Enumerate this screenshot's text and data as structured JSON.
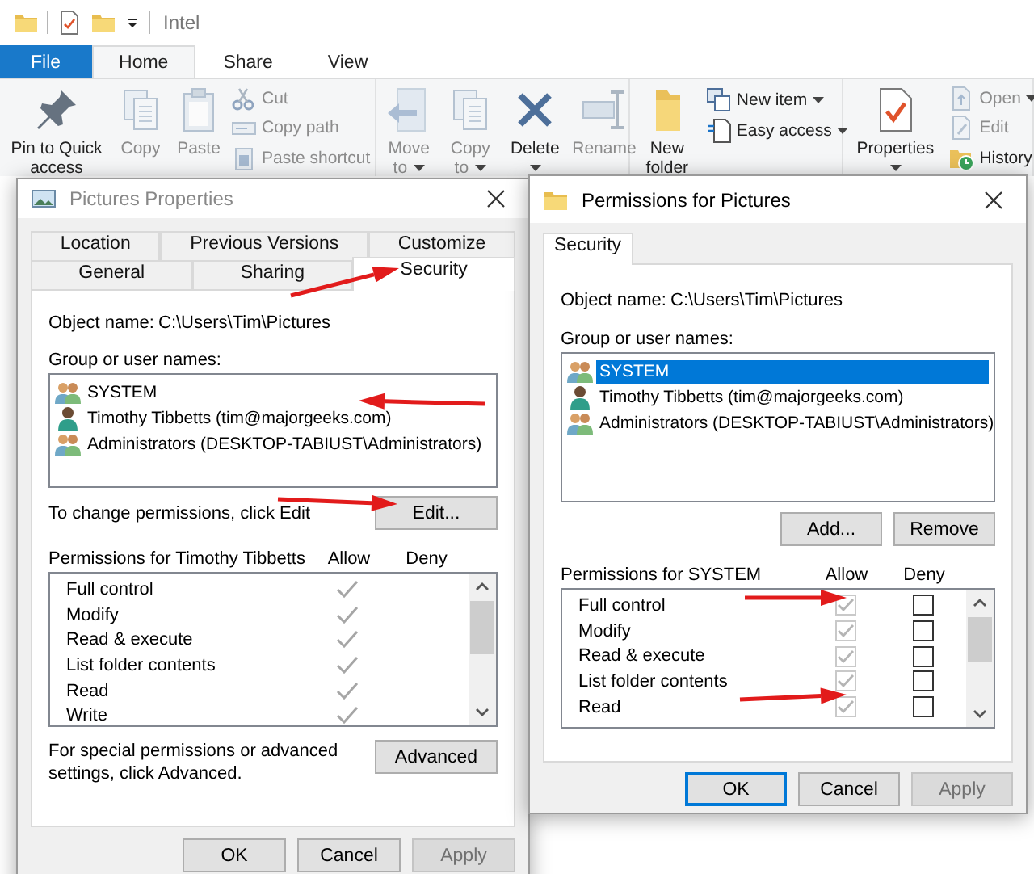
{
  "explorer": {
    "title": "Intel",
    "tabs": [
      {
        "label": "File",
        "kind": "file",
        "selected": false
      },
      {
        "label": "Home",
        "kind": "tab",
        "selected": true
      },
      {
        "label": "Share",
        "kind": "tab",
        "selected": false
      },
      {
        "label": "View",
        "kind": "tab",
        "selected": false
      }
    ],
    "ribbon_groups": [
      {
        "large": [
          {
            "label": "Pin to Quick access",
            "disabled": false,
            "dropdown": false
          },
          {
            "label": "Copy",
            "disabled": true,
            "dropdown": false
          },
          {
            "label": "Paste",
            "disabled": true,
            "dropdown": false
          }
        ],
        "small": [
          {
            "label": "Cut",
            "disabled": true,
            "dropdown": false
          },
          {
            "label": "Copy path",
            "disabled": true,
            "dropdown": false
          },
          {
            "label": "Paste shortcut",
            "disabled": true,
            "dropdown": false
          }
        ]
      },
      {
        "large": [
          {
            "label": "Move to",
            "disabled": true,
            "dropdown": true
          },
          {
            "label": "Copy to",
            "disabled": true,
            "dropdown": true
          },
          {
            "label": "Delete",
            "disabled": false,
            "dropdown": true
          },
          {
            "label": "Rename",
            "disabled": true,
            "dropdown": false
          }
        ]
      },
      {
        "large": [
          {
            "label": "New folder",
            "disabled": false,
            "dropdown": false
          }
        ],
        "small": [
          {
            "label": "New item",
            "disabled": false,
            "dropdown": true
          },
          {
            "label": "Easy access",
            "disabled": false,
            "dropdown": true
          }
        ]
      },
      {
        "large": [
          {
            "label": "Properties",
            "disabled": false,
            "dropdown": true
          }
        ],
        "small": [
          {
            "label": "Open",
            "disabled": true,
            "dropdown": true
          },
          {
            "label": "Edit",
            "disabled": true,
            "dropdown": false
          },
          {
            "label": "History",
            "disabled": false,
            "dropdown": false
          }
        ]
      }
    ]
  },
  "properties_dialog": {
    "title": "Pictures Properties",
    "tab_rows": [
      [
        {
          "label": "Location",
          "selected": false
        },
        {
          "label": "Previous Versions",
          "selected": false
        },
        {
          "label": "Customize",
          "selected": false
        }
      ],
      [
        {
          "label": "General",
          "selected": false
        },
        {
          "label": "Sharing",
          "selected": false
        },
        {
          "label": "Security",
          "selected": true
        }
      ]
    ],
    "object_label": "Object name:",
    "object_value": "C:\\Users\\Tim\\Pictures",
    "users_label": "Group or user names:",
    "users": [
      {
        "name": "SYSTEM",
        "kind": "group",
        "selected": false
      },
      {
        "name": "Timothy Tibbetts (tim@majorgeeks.com)",
        "kind": "user",
        "selected": false
      },
      {
        "name": "Administrators (DESKTOP-TABIUST\\Administrators)",
        "kind": "group",
        "selected": false
      }
    ],
    "change_hint": "To change permissions, click Edit",
    "edit_button": "Edit...",
    "permissions_label": "Permissions for Timothy Tibbetts",
    "allow_label": "Allow",
    "deny_label": "Deny",
    "permissions": [
      {
        "label": "Full control",
        "allow": true,
        "deny": false
      },
      {
        "label": "Modify",
        "allow": true,
        "deny": false
      },
      {
        "label": "Read & execute",
        "allow": true,
        "deny": false
      },
      {
        "label": "List folder contents",
        "allow": true,
        "deny": false
      },
      {
        "label": "Read",
        "allow": true,
        "deny": false
      },
      {
        "label": "Write",
        "allow": true,
        "deny": false
      }
    ],
    "advanced_hint": "For special permissions or advanced settings, click Advanced.",
    "advanced_button": "Advanced",
    "buttons": [
      {
        "label": "OK",
        "default": false,
        "disabled": false
      },
      {
        "label": "Cancel",
        "default": false,
        "disabled": false
      },
      {
        "label": "Apply",
        "default": false,
        "disabled": true
      }
    ]
  },
  "permissions_dialog": {
    "title": "Permissions for Pictures",
    "tabs": [
      {
        "label": "Security",
        "selected": true
      }
    ],
    "object_label": "Object name:",
    "object_value": "C:\\Users\\Tim\\Pictures",
    "users_label": "Group or user names:",
    "users": [
      {
        "name": "SYSTEM",
        "kind": "group",
        "selected": true
      },
      {
        "name": "Timothy Tibbetts (tim@majorgeeks.com)",
        "kind": "user",
        "selected": false
      },
      {
        "name": "Administrators (DESKTOP-TABIUST\\Administrators)",
        "kind": "group",
        "selected": false
      }
    ],
    "user_buttons": [
      "Add...",
      "Remove"
    ],
    "permissions_label": "Permissions for SYSTEM",
    "allow_label": "Allow",
    "deny_label": "Deny",
    "permissions": [
      {
        "label": "Full control",
        "allow": true,
        "allow_disabled": true,
        "deny": false
      },
      {
        "label": "Modify",
        "allow": true,
        "allow_disabled": true,
        "deny": false
      },
      {
        "label": "Read & execute",
        "allow": true,
        "allow_disabled": true,
        "deny": false
      },
      {
        "label": "List folder contents",
        "allow": true,
        "allow_disabled": true,
        "deny": false
      },
      {
        "label": "Read",
        "allow": true,
        "allow_disabled": true,
        "deny": false
      }
    ],
    "buttons": [
      {
        "label": "OK",
        "default": true,
        "disabled": false
      },
      {
        "label": "Cancel",
        "default": false,
        "disabled": false
      },
      {
        "label": "Apply",
        "default": false,
        "disabled": true
      }
    ]
  }
}
